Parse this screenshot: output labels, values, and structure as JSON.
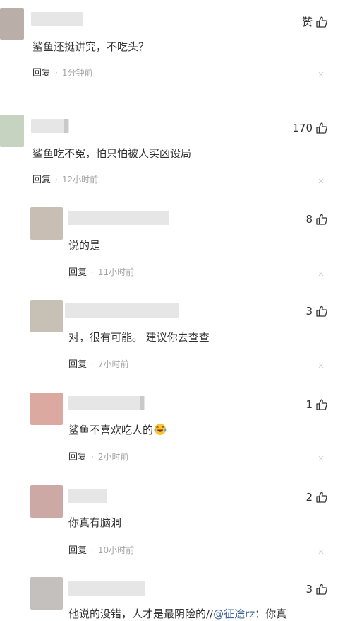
{
  "comments": [
    {
      "avatar_color": "#b9afa8",
      "text": "鲨鱼还挺讲究，不吃头？",
      "reply_label": "回复",
      "time": "1分钟前",
      "likes": "赞",
      "has_close": true
    },
    {
      "avatar_color": "#c5d3c0",
      "text": "鲨鱼吃不冤，怕只怕被人买凶设局",
      "reply_label": "回复",
      "time": "12小时前",
      "likes": "170",
      "has_close": true
    },
    {
      "avatar_color": "#c8beb4",
      "text": "说的是",
      "reply_label": "回复",
      "time": "11小时前",
      "likes": "8",
      "has_close": true
    },
    {
      "avatar_color": "#c7c0b5",
      "text": "对，很有可能。 建议你去查查",
      "reply_label": "回复",
      "time": "7小时前",
      "likes": "3",
      "has_close": true
    },
    {
      "avatar_color": "#dba9a0",
      "text": "鲨鱼不喜欢吃人的",
      "emoji": "laughing-crying-emoji",
      "reply_label": "回复",
      "time": "2小时前",
      "likes": "1",
      "has_close": true
    },
    {
      "avatar_color": "#cda9a6",
      "text": "你真有脑洞",
      "reply_label": "回复",
      "time": "10小时前",
      "likes": "2",
      "has_close": true
    },
    {
      "avatar_color": "#c4c0be",
      "text_prefix": "他说的没错，人才是最阴险的//",
      "mention": "@征途rz",
      "text_suffix": "：你真",
      "likes": "3"
    }
  ],
  "colors": {
    "text": "#333333",
    "meta": "#a5a5a5",
    "mention": "#406599",
    "name_placeholder": "#e6e6e6"
  }
}
